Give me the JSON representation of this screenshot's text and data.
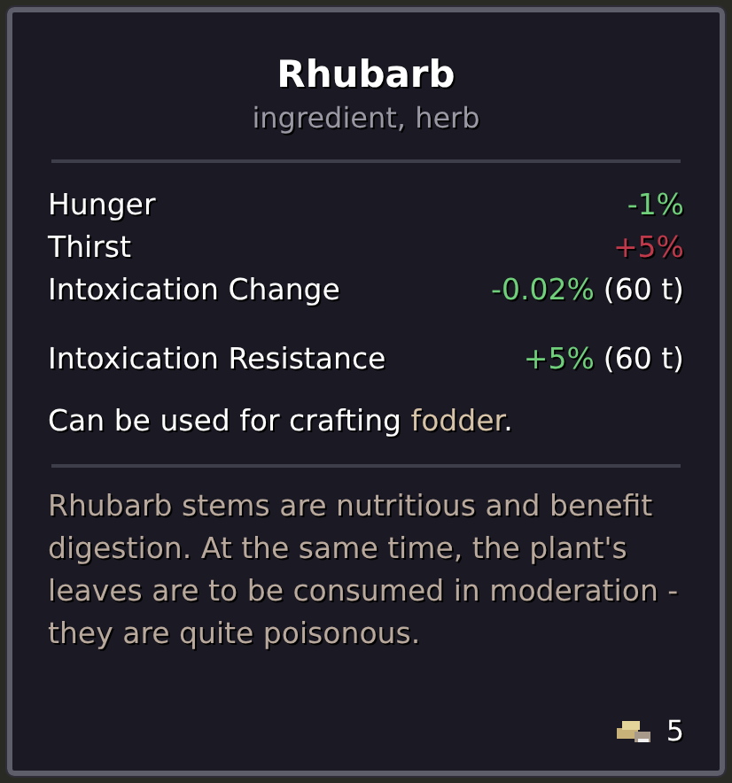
{
  "item": {
    "name": "Rhubarb",
    "tags": "ingredient, herb"
  },
  "stat_groups": [
    [
      {
        "label": "Hunger",
        "value": "-1%",
        "color": "#6fcf7a"
      },
      {
        "label": "Thirst",
        "value": "+5%",
        "color": "#c0394a"
      },
      {
        "label": "Intoxication Change",
        "value": "-0.02%",
        "color": "#6fcf7a",
        "duration": "(60 t)"
      }
    ],
    [
      {
        "label": "Intoxication Resistance",
        "value": "+5%",
        "color": "#6fcf7a",
        "duration": "(60 t)"
      }
    ]
  ],
  "crafting": {
    "before": "Can be used for crafting ",
    "highlight": "fodder",
    "after": "."
  },
  "description": "Rhubarb stems are nutritious and benefit digestion. At the same time, the plant's leaves are to be consumed in moderation - they are quite poisonous.",
  "price": "5"
}
